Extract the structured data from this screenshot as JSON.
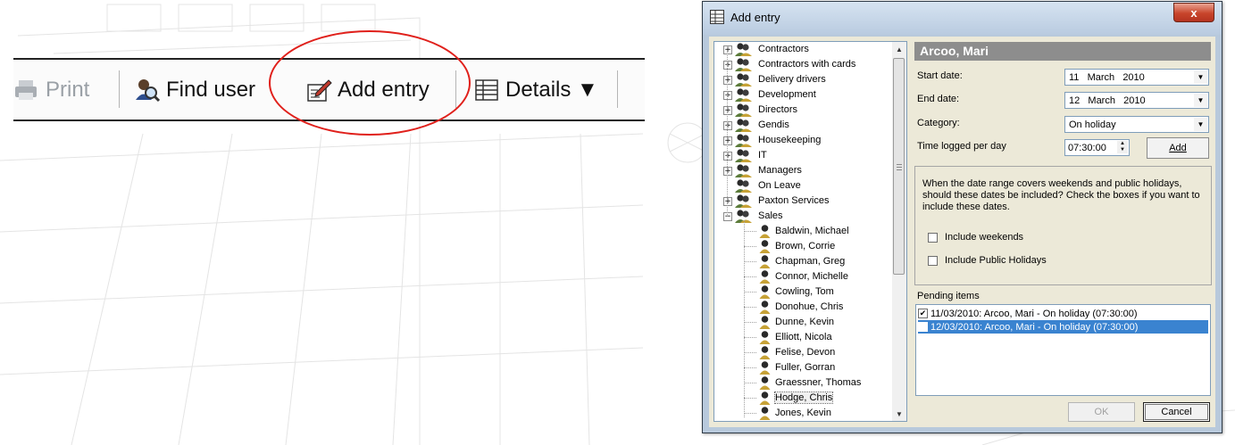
{
  "toolbar": {
    "items": [
      {
        "label": "Print",
        "icon": "printer-icon",
        "enabled": false
      },
      {
        "label": "Find user",
        "icon": "find-user-icon"
      },
      {
        "label": "Add entry",
        "icon": "add-entry-icon",
        "highlighted": true
      },
      {
        "label": "Details ▼",
        "icon": "details-grid-icon"
      }
    ],
    "highlight_color": "#e0201b"
  },
  "dialog": {
    "title": "Add entry",
    "close_label": "x",
    "tree": {
      "groups": [
        {
          "label": "Contractors",
          "expander": "+"
        },
        {
          "label": "Contractors with cards",
          "expander": "+"
        },
        {
          "label": "Delivery drivers",
          "expander": "+"
        },
        {
          "label": "Development",
          "expander": "+"
        },
        {
          "label": "Directors",
          "expander": "+"
        },
        {
          "label": "Gendis",
          "expander": "+"
        },
        {
          "label": "Housekeeping",
          "expander": "+"
        },
        {
          "label": "IT",
          "expander": "+"
        },
        {
          "label": "Managers",
          "expander": "+"
        },
        {
          "label": "On Leave",
          "expander": ""
        },
        {
          "label": "Paxton Services",
          "expander": "+"
        },
        {
          "label": "Sales",
          "expander": "−"
        }
      ],
      "sales_members": [
        "Baldwin, Michael",
        "Brown, Corrie",
        "Chapman, Greg",
        "Connor, Michelle",
        "Cowling, Tom",
        "Donohue, Chris",
        "Dunne, Kevin",
        "Elliott, Nicola",
        "Felise, Devon",
        "Fuller, Gorran",
        "Graessner, Thomas",
        "Hodge, Chris",
        "Jones, Kevin"
      ],
      "selected": "Hodge, Chris"
    },
    "user_name": "Arcoo, Mari",
    "form": {
      "start_date_label": "Start date:",
      "start_date_value": "11   March   2010",
      "end_date_label": "End date:",
      "end_date_value": "12   March   2010",
      "category_label": "Category:",
      "category_value": "On holiday",
      "time_label": "Time logged per day",
      "time_value": "07:30:00",
      "add_label": "Add"
    },
    "info_text": "When the date range covers weekends and public holidays, should these dates be included?  Check the boxes if you want to include these dates.",
    "include_weekends_label": "Include weekends",
    "include_weekends_checked": false,
    "include_holidays_label": "Include Public Holidays",
    "include_holidays_checked": false,
    "pending_label": "Pending items",
    "pending_items": [
      {
        "text": "11/03/2010: Arcoo, Mari - On holiday (07:30:00)",
        "checked": true,
        "selected": false
      },
      {
        "text": "12/03/2010: Arcoo, Mari - On holiday (07:30:00)",
        "checked": true,
        "selected": true
      }
    ],
    "ok_label": "OK",
    "cancel_label": "Cancel",
    "selection_color": "#3a83d0"
  }
}
